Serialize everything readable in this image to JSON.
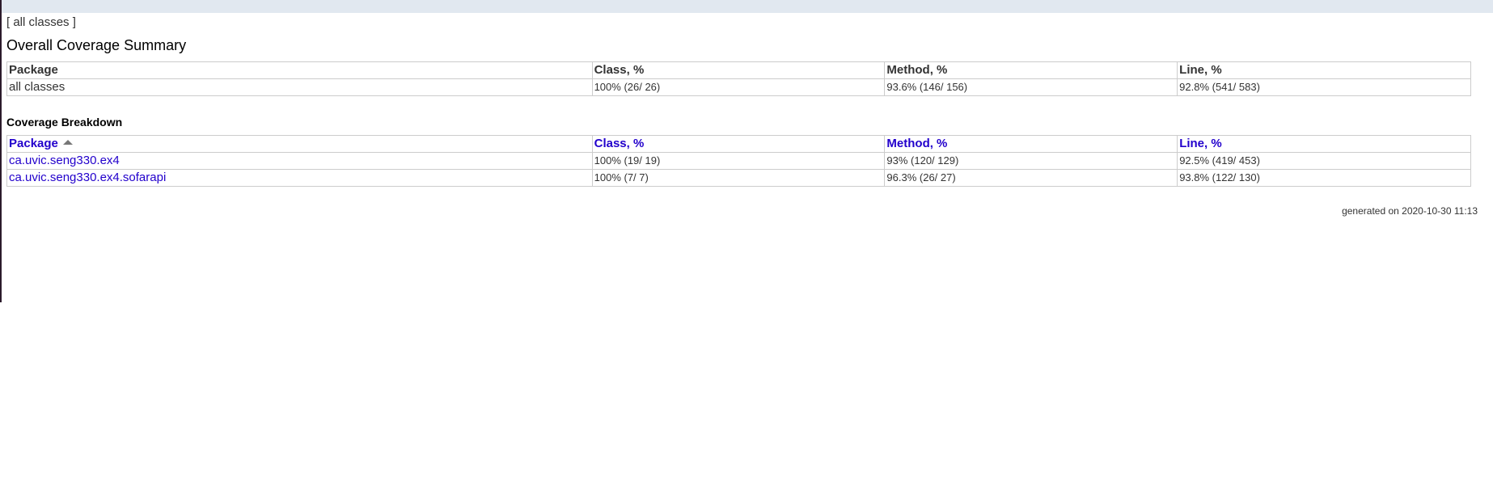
{
  "nav": {
    "open_bracket": "[",
    "all_classes_label": "all classes",
    "close_bracket": "]"
  },
  "summary": {
    "title": "Overall Coverage Summary",
    "headers": [
      "Package",
      "Class, %",
      "Method, %",
      "Line, %"
    ],
    "rows": [
      {
        "package": "all classes",
        "class": "100% (26/ 26)",
        "method": "93.6% (146/ 156)",
        "line": "92.8% (541/ 583)"
      }
    ]
  },
  "breakdown": {
    "title": "Coverage Breakdown",
    "headers": [
      "Package",
      "Class, %",
      "Method, %",
      "Line, %"
    ],
    "sort_icon": "sort-ascending-icon",
    "rows": [
      {
        "package": "ca.uvic.seng330.ex4",
        "class": "100% (19/ 19)",
        "method": "93% (120/ 129)",
        "line": "92.5% (419/ 453)"
      },
      {
        "package": "ca.uvic.seng330.ex4.sofarapi",
        "class": "100% (7/ 7)",
        "method": "96.3% (26/ 27)",
        "line": "93.8% (122/ 130)"
      }
    ]
  },
  "footer": {
    "generated": "generated on 2020-10-30 11:13"
  },
  "colors": {
    "link": "#2200cc",
    "top_band": "#e1e8f0",
    "border": "#cccccc"
  }
}
